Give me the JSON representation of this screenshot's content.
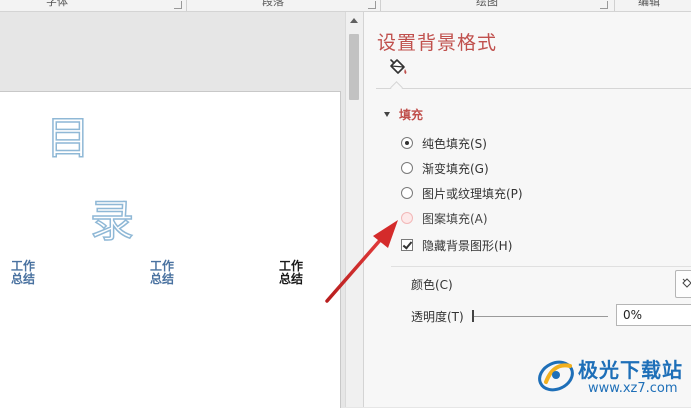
{
  "ribbon": {
    "groups": [
      {
        "label": "字体"
      },
      {
        "label": "段落"
      },
      {
        "label": "绘图"
      },
      {
        "label": "编辑"
      }
    ]
  },
  "slide": {
    "heading_char_1": "目",
    "heading_char_2": "录",
    "items": [
      {
        "line1": "工作",
        "line2": "总结"
      },
      {
        "line1": "工作",
        "line2": "总结"
      },
      {
        "line1": "工作",
        "line2": "总结"
      }
    ]
  },
  "pane": {
    "title": "设置背景格式",
    "tab_icon": "paint-bucket-icon",
    "section_label": "填充",
    "fill_options": [
      {
        "label": "纯色填充(S)",
        "checked": true
      },
      {
        "label": "渐变填充(G)",
        "checked": false
      },
      {
        "label": "图片或纹理填充(P)",
        "checked": false
      },
      {
        "label": "图案填充(A)",
        "checked": false
      }
    ],
    "hide_bg_label": "隐藏背景图形(H)",
    "color_label": "颜色(C)",
    "transparency_label": "透明度(T)",
    "transparency_value": "0%"
  },
  "watermark": {
    "title": "极光下载站",
    "url": "www.xz7.com"
  },
  "colors": {
    "accent": "#c0504d",
    "annotation_arrow": "#d42b2b"
  }
}
